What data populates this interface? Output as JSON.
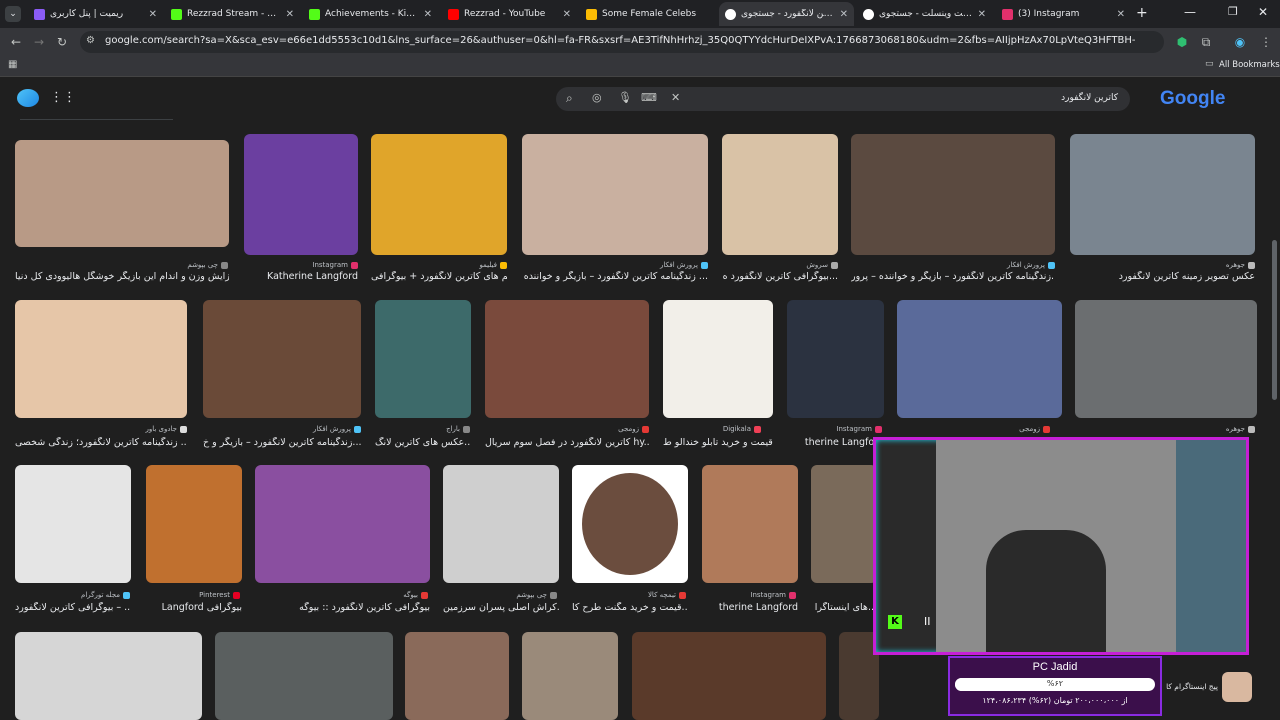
{
  "tabs": [
    {
      "title": "ریمیت | پنل کاربری",
      "favicon_color": "#8b5cf6"
    },
    {
      "title": "Rezzrad Stream - Watch Li",
      "favicon_color": "#53fc18"
    },
    {
      "title": "Achievements - Kick Dashb",
      "favicon_color": "#53fc18"
    },
    {
      "title": "Rezzrad - YouTube",
      "favicon_color": "#ff0000"
    },
    {
      "title": "Some Female Celebs",
      "favicon_color": "#fbbc04"
    },
    {
      "title": "کاترین لانگفورد - جستجوی Go",
      "favicon_color": "#ffffff",
      "active": true
    },
    {
      "title": "کیت وینسلت - جستجوی Go",
      "favicon_color": "#ffffff"
    },
    {
      "title": "(3) Instagram",
      "favicon_color": "#e1306c"
    }
  ],
  "toolbar": {
    "url": "google.com/search?sa=X&sca_esv=e66e1dd5553c10d1&lns_surface=26&authuser=0&hl=fa-FR&sxsrf=AE3TifNhHrhzj_35Q0QTYYdcHurDeIXPvA:1766873068180&udm=2&fbs=AIIjpHzAx70LpVteQ3HFTBH-UbSXkJwSfrgFwbmI2z_c8Q7HSS2O4cDcLQj...",
    "bookmarks_label": "All Bookmarks"
  },
  "search": {
    "query": "کاترین لانگفورد",
    "logo": "Google"
  },
  "results": [
    {
      "src": "چی بپوشم",
      "cap": "افزایش وزن و اندام این بازیگر خوشگل هالیوودی کل دنیا...",
      "color": "#b89a86"
    },
    {
      "src": "Instagram",
      "cap": "Katherine Langford",
      "color": "#6b3fa0"
    },
    {
      "src": "فیلیمو",
      "cap": "فیلم های کاترین لانگفورد + بیوگرافی",
      "color": "#e0a52a"
    },
    {
      "src": "پرورش افکار",
      "cap": "زندگینامه کاترین لانگفورد – بازیگر و خواننده ...",
      "color": "#c9b0a0"
    },
    {
      "src": "سروش",
      "cap": "بیوگرافی کاترین لانگفورد ه...",
      "color": "#d9c2a6"
    },
    {
      "src": "پرورش افکار",
      "cap": "زندگینامه کاترین لانگفورد – بازیگر و خواننده – پرور...",
      "color": "#5b4a40"
    },
    {
      "src": "جوهره",
      "cap": "عکس تصویر زمینه کاترین لانگفورد",
      "color": "#7a8590"
    },
    {
      "src": "جادوی باور",
      "cap": "زندگینامه کاترین لانگفورد؛ زندگی شخصی ...",
      "color": "#e6c6a8"
    },
    {
      "src": "پرورش افکار",
      "cap": "زندگینامه کاترین لانگفورد – بازیگر و خ...",
      "color": "#6a4a38"
    },
    {
      "src": "باراج",
      "cap": "عکس های کاترین لانگ...",
      "color": "#3d6a6a"
    },
    {
      "src": "زومجی",
      "cap": "کاترین لانگفورد در فصل سوم سریال hy...",
      "color": "#7a4a3c"
    },
    {
      "src": "Digikala",
      "cap": "قیمت و خرید تابلو خندالو ط...",
      "color": "#f2efe9"
    },
    {
      "src": "Instagram",
      "cap": "therine Langford",
      "color": "#2b3240"
    },
    {
      "src": "زومجی",
      "cap": "",
      "color": "#5a6a9a"
    },
    {
      "src": "جوهره",
      "cap": "جد",
      "color": "#6b6e70"
    },
    {
      "src": "مجله تورگرام",
      "cap": "بیوگرافی کاترین لانگفورد – ...",
      "color": "#e5e5e5"
    },
    {
      "src": "Pinterest",
      "cap": "Langford بیوگرافی",
      "color": "#c0702f"
    },
    {
      "src": "بیوگه",
      "cap": "بیوگرافی کاترین لانگفورد :: بیوگه",
      "color": "#8a4fa0"
    },
    {
      "src": "چی بپوشم",
      "cap": "کراش اصلی پسران سرزمین...",
      "color": "#cfcfcf"
    },
    {
      "src": "تیمچه کالا",
      "cap": "قیمت و خرید مگنت طرح کا...",
      "color": "#ffffff"
    },
    {
      "src": "Instagram",
      "cap": "therine Langford",
      "color": "#b07a5a"
    },
    {
      "src": "",
      "cap": "های اینستاگرا...",
      "color": "#7a6a5a"
    },
    {
      "src": "",
      "cap": "پیج اینستاگرام کا",
      "color": "#aaaaaa"
    }
  ],
  "overlay": {
    "title": "PC Jadid",
    "progress_label": "%۶۲",
    "progress_percent": 62,
    "amount_text": "۱۲۴،۰۸۶،۲۳۴ از ۲۰۰،۰۰۰،۰۰۰ تومان (۶۲%)",
    "accent": "#c51fd6"
  }
}
